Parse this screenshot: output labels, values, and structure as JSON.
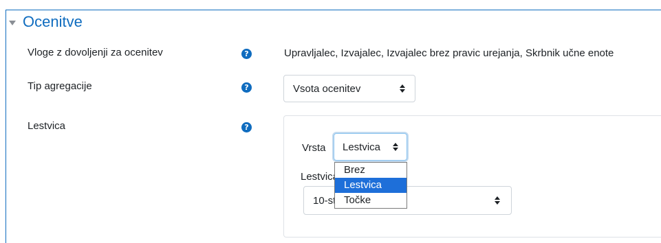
{
  "section": {
    "title": "Ocenitve"
  },
  "fields": {
    "roles": {
      "label": "Vloge z dovoljenji za ocenitev",
      "value": "Upravljalec, Izvajalec, Izvajalec brez pravic urejanja, Skrbnik učne enote"
    },
    "aggregation": {
      "label": "Tip agregacije",
      "selected": "Vsota ocenitev"
    },
    "scale": {
      "label": "Lestvica",
      "type_label": "Vrsta",
      "type_selected": "Lestvica",
      "scale_label": "Lestvica",
      "scale_selected": "10-stopenjska",
      "type_options": [
        "Brez",
        "Lestvica",
        "Točke"
      ]
    }
  },
  "help_icon_glyph": "?",
  "colors": {
    "accent": "#0f6cbf",
    "selected_option": "#1e6fd9"
  }
}
